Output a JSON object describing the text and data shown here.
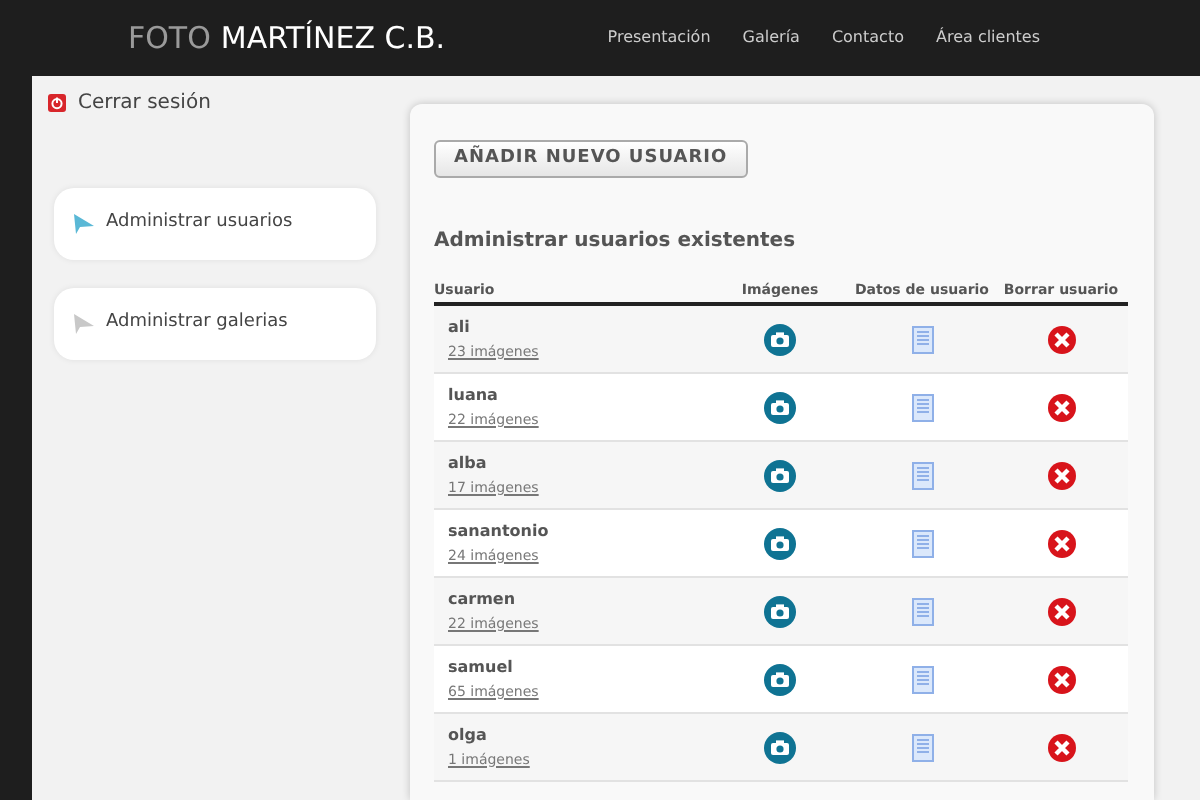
{
  "header": {
    "logo_light": "FOTO",
    "logo_bold": "MARTÍNEZ C.B.",
    "nav": [
      "Presentación",
      "Galería",
      "Contacto",
      "Área clientes"
    ]
  },
  "logout": "Cerrar sesión",
  "sidebar": {
    "items": [
      {
        "label": "Administrar usuarios",
        "selected": true
      },
      {
        "label": "Administrar galerias",
        "selected": false
      }
    ]
  },
  "add_button": "AÑADIR NUEVO USUARIO",
  "section_title": "Administrar usuarios existentes",
  "table": {
    "columns": [
      "Usuario",
      "Imágenes",
      "Datos de usuario",
      "Borrar usuario"
    ],
    "rows": [
      {
        "user": "ali",
        "images": "23 imágenes"
      },
      {
        "user": "luana",
        "images": "22 imágenes"
      },
      {
        "user": "alba",
        "images": "17 imágenes"
      },
      {
        "user": "sanantonio",
        "images": "24 imágenes"
      },
      {
        "user": "carmen",
        "images": "22 imágenes"
      },
      {
        "user": "samuel",
        "images": "65 imágenes"
      },
      {
        "user": "olga",
        "images": "1 imágenes"
      }
    ]
  }
}
